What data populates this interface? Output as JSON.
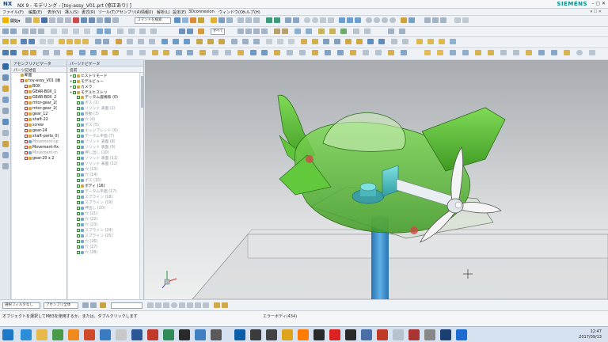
{
  "titlebar": {
    "logo": "NX",
    "title": "NX 9 - モデリング - [toy-assy_V01.prt (修正あり) ]",
    "brand": "SIEMENS",
    "window_controls": "–  ▢  ✕"
  },
  "menubar": {
    "items": [
      "ファイル(F)",
      "編集(E)",
      "表示(V)",
      "挿入(S)",
      "書式(R)",
      "ツール(T)",
      "アセンブリ(A)",
      "情報(I)",
      "解析(L)",
      "設定(E)",
      "3Dconnexion",
      "ウィンドウ(O)",
      "ヘルプ(H)"
    ],
    "right": "▾ ☐ ✕"
  },
  "toolbar": {
    "start_label": "開始▾",
    "command_search_placeholder": "コマンドを検索",
    "filter_combo": "すべて"
  },
  "assembly_navigator": {
    "title": "アセンブリナビゲータ",
    "column": "パーツ記述名",
    "rows": [
      {
        "label": "断面",
        "indent": 1,
        "check": "none",
        "dim": false
      },
      {
        "label": "toy-assy_V01 (順",
        "indent": 1,
        "check": "r",
        "dim": false
      },
      {
        "label": "BOX",
        "indent": 2,
        "check": "r",
        "dim": false
      },
      {
        "label": "GEAR-BOX_1",
        "indent": 2,
        "check": "r",
        "dim": false
      },
      {
        "label": "GEAR-BOX_2",
        "indent": 2,
        "check": "r",
        "dim": false
      },
      {
        "label": "mtor-gear_2(",
        "indent": 2,
        "check": "r",
        "dim": false
      },
      {
        "label": "mtor-gear_2(",
        "indent": 2,
        "check": "r",
        "dim": false
      },
      {
        "label": "gear_12",
        "indent": 2,
        "check": "r",
        "dim": false
      },
      {
        "label": "shaft-22",
        "indent": 2,
        "check": "r",
        "dim": false
      },
      {
        "label": "screw",
        "indent": 2,
        "check": "r",
        "dim": false
      },
      {
        "label": "gear-24",
        "indent": 2,
        "check": "r",
        "dim": false
      },
      {
        "label": "shaft-parts_0(",
        "indent": 2,
        "check": "r",
        "dim": false
      },
      {
        "label": "Movement-sp",
        "indent": 2,
        "check": "r",
        "dim": true
      },
      {
        "label": "Movement-fix",
        "indent": 2,
        "check": "r",
        "dim": false
      },
      {
        "label": "Movement-m",
        "indent": 2,
        "check": "r",
        "dim": true
      },
      {
        "label": "gear-20 x 2",
        "indent": 2,
        "check": "r",
        "dim": false
      }
    ]
  },
  "part_navigator": {
    "title": "パーツナビゲータ",
    "column": "名前",
    "rows": [
      {
        "label": "ヒストリモード",
        "indent": 0,
        "dim": false
      },
      {
        "label": "モデルビュー",
        "indent": 0,
        "dim": false
      },
      {
        "label": "カメラ",
        "indent": 0,
        "dim": false
      },
      {
        "label": "モデルヒストリ",
        "indent": 0,
        "dim": false
      },
      {
        "label": "データム座標系 (0)",
        "indent": 1,
        "dim": false
      },
      {
        "label": "ボス (1)",
        "indent": 1,
        "dim": true
      },
      {
        "label": "ソリッド 表面 (2)",
        "indent": 1,
        "dim": true
      },
      {
        "label": "移動 (3)",
        "indent": 1,
        "dim": true
      },
      {
        "label": "穴 (4)",
        "indent": 1,
        "dim": true
      },
      {
        "label": "ボス (5)",
        "indent": 1,
        "dim": true
      },
      {
        "label": "エッジブレンド (6)",
        "indent": 1,
        "dim": true
      },
      {
        "label": "データム平面 (7)",
        "indent": 1,
        "dim": true
      },
      {
        "label": "ソリッド 表面 (8)",
        "indent": 1,
        "dim": true
      },
      {
        "label": "ソリッド 表面 (9)",
        "indent": 1,
        "dim": true
      },
      {
        "label": "押し出し (10)",
        "indent": 1,
        "dim": true
      },
      {
        "label": "ソリッド 表面 (11)",
        "indent": 1,
        "dim": true
      },
      {
        "label": "ソリッド 表面 (12)",
        "indent": 1,
        "dim": true
      },
      {
        "label": "穴 (13)",
        "indent": 1,
        "dim": true
      },
      {
        "label": "穴 (14)",
        "indent": 1,
        "dim": true
      },
      {
        "label": "ボス (15)",
        "indent": 1,
        "dim": true
      },
      {
        "label": "ボディ (16)",
        "indent": 1,
        "dim": false
      },
      {
        "label": "データム平面 (17)",
        "indent": 1,
        "dim": true
      },
      {
        "label": "スプライン (18)",
        "indent": 1,
        "dim": true
      },
      {
        "label": "スプライン (19)",
        "indent": 1,
        "dim": true
      },
      {
        "label": "押出し (20)",
        "indent": 1,
        "dim": true
      },
      {
        "label": "穴 (21)",
        "indent": 1,
        "dim": true
      },
      {
        "label": "穴 (22)",
        "indent": 1,
        "dim": true
      },
      {
        "label": "穴 (23)",
        "indent": 1,
        "dim": true
      },
      {
        "label": "スプライン (24)",
        "indent": 1,
        "dim": true
      },
      {
        "label": "スプライン (25)",
        "indent": 1,
        "dim": true
      },
      {
        "label": "穴 (26)",
        "indent": 1,
        "dim": true
      },
      {
        "label": "穴 (27)",
        "indent": 1,
        "dim": true
      },
      {
        "label": "穴 (28)",
        "indent": 1,
        "dim": true
      }
    ]
  },
  "bottom_toolbar": {
    "filter": "選択フィルタなし",
    "scope": "アセンブリ全体"
  },
  "status": {
    "message": "オブジェクトを選択してMB3を使用するか、または、ダブルクリックします",
    "selection": "エラーボディ(434)"
  },
  "clock": {
    "time": "12:47",
    "date": "2017/09/13"
  },
  "colors": {
    "accent": "#0a8f8a",
    "plane_green": "#5fc43a",
    "shaft_cyan": "#4fbcbf",
    "post_blue": "#3a8fc9"
  }
}
